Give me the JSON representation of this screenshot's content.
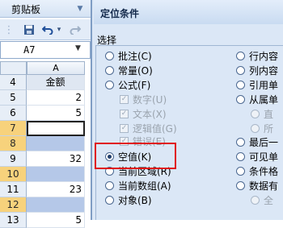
{
  "excel": {
    "clipboard_label": "剪贴板",
    "clipboard_close": "▼",
    "quick_access": {
      "save_icon": "save-icon",
      "undo_icon": "undo-icon",
      "undo_arrow": "▾",
      "redo_icon": "redo-icon"
    },
    "name_box": {
      "value": "A7",
      "dropdown": "▼"
    },
    "column_header": "A",
    "rows": [
      {
        "num": "4",
        "value": "金额"
      },
      {
        "num": "5",
        "value": "2"
      },
      {
        "num": "6",
        "value": "5"
      },
      {
        "num": "7",
        "value": ""
      },
      {
        "num": "8",
        "value": ""
      },
      {
        "num": "9",
        "value": "32"
      },
      {
        "num": "10",
        "value": ""
      },
      {
        "num": "11",
        "value": "23"
      },
      {
        "num": "12",
        "value": ""
      },
      {
        "num": "13",
        "value": "5"
      }
    ]
  },
  "dialog": {
    "title": "定位条件",
    "group_label": "选择",
    "left_options": [
      "批注(C)",
      "常量(O)",
      "公式(F)",
      "数字(U)",
      "文本(X)",
      "逻辑值(G)",
      "错误(E)",
      "空值(K)",
      "当前区域(R)",
      "当前数组(A)",
      "对象(B)"
    ],
    "right_options": [
      "行内容",
      "列内容",
      "引用单",
      "从属单",
      "直",
      "所",
      "最后一",
      "可见单",
      "条件格",
      "数据有",
      "全"
    ]
  }
}
